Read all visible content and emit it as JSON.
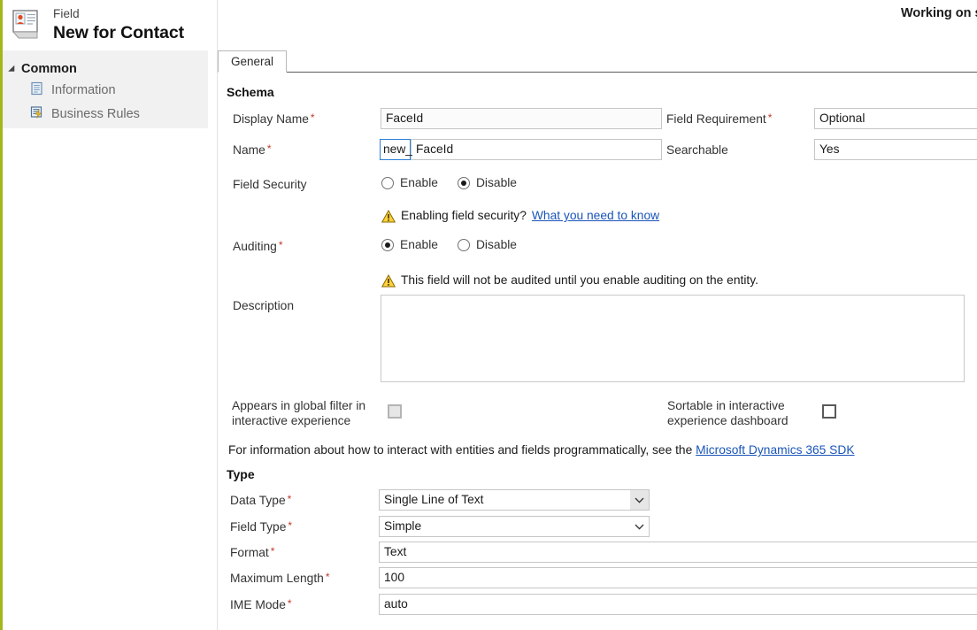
{
  "header": {
    "entity_label": "Field",
    "title": "New for Contact",
    "status_text": "Working on s",
    "icon": "contact-card-icon"
  },
  "sidebar": {
    "group_label": "Common",
    "items": [
      {
        "label": "Information",
        "icon": "document-icon"
      },
      {
        "label": "Business Rules",
        "icon": "business-rules-icon"
      }
    ]
  },
  "tabs": [
    {
      "label": "General",
      "active": true
    }
  ],
  "sections": {
    "schema_title": "Schema",
    "type_title": "Type"
  },
  "schema": {
    "display_name_label": "Display Name",
    "display_name_value": "FaceId",
    "name_label": "Name",
    "name_prefix": "new_",
    "name_value": "FaceId",
    "field_requirement_label": "Field Requirement",
    "field_requirement_value": "Optional",
    "searchable_label": "Searchable",
    "searchable_value": "Yes",
    "field_security_label": "Field Security",
    "field_security_enable": "Enable",
    "field_security_disable": "Disable",
    "field_security_selected": "Disable",
    "field_security_warning": "Enabling field security?",
    "field_security_link": "What you need to know",
    "auditing_label": "Auditing",
    "auditing_enable": "Enable",
    "auditing_disable": "Disable",
    "auditing_selected": "Enable",
    "auditing_warning": "This field will not be audited until you enable auditing on the entity.",
    "description_label": "Description",
    "description_value": "",
    "global_filter_label": "Appears in global filter in interactive experience",
    "global_filter_checked": false,
    "global_filter_disabled": true,
    "sortable_label": "Sortable in interactive experience dashboard",
    "sortable_checked": false,
    "sortable_disabled": false,
    "sdk_note": "For information about how to interact with entities and fields programmatically, see the",
    "sdk_link": "Microsoft Dynamics 365 SDK"
  },
  "type": {
    "data_type_label": "Data Type",
    "data_type_value": "Single Line of Text",
    "field_type_label": "Field Type",
    "field_type_value": "Simple",
    "format_label": "Format",
    "format_value": "Text",
    "max_length_label": "Maximum Length",
    "max_length_value": "100",
    "ime_mode_label": "IME Mode",
    "ime_mode_value": "auto"
  },
  "colors": {
    "accent_olive": "#a3b61a",
    "required_red": "#c1392b",
    "link_blue": "#1a55b8",
    "focus_blue": "#2a7fd4",
    "warning_yellow": "#ffd23a",
    "sidebar_bg": "#f1f1f1"
  }
}
